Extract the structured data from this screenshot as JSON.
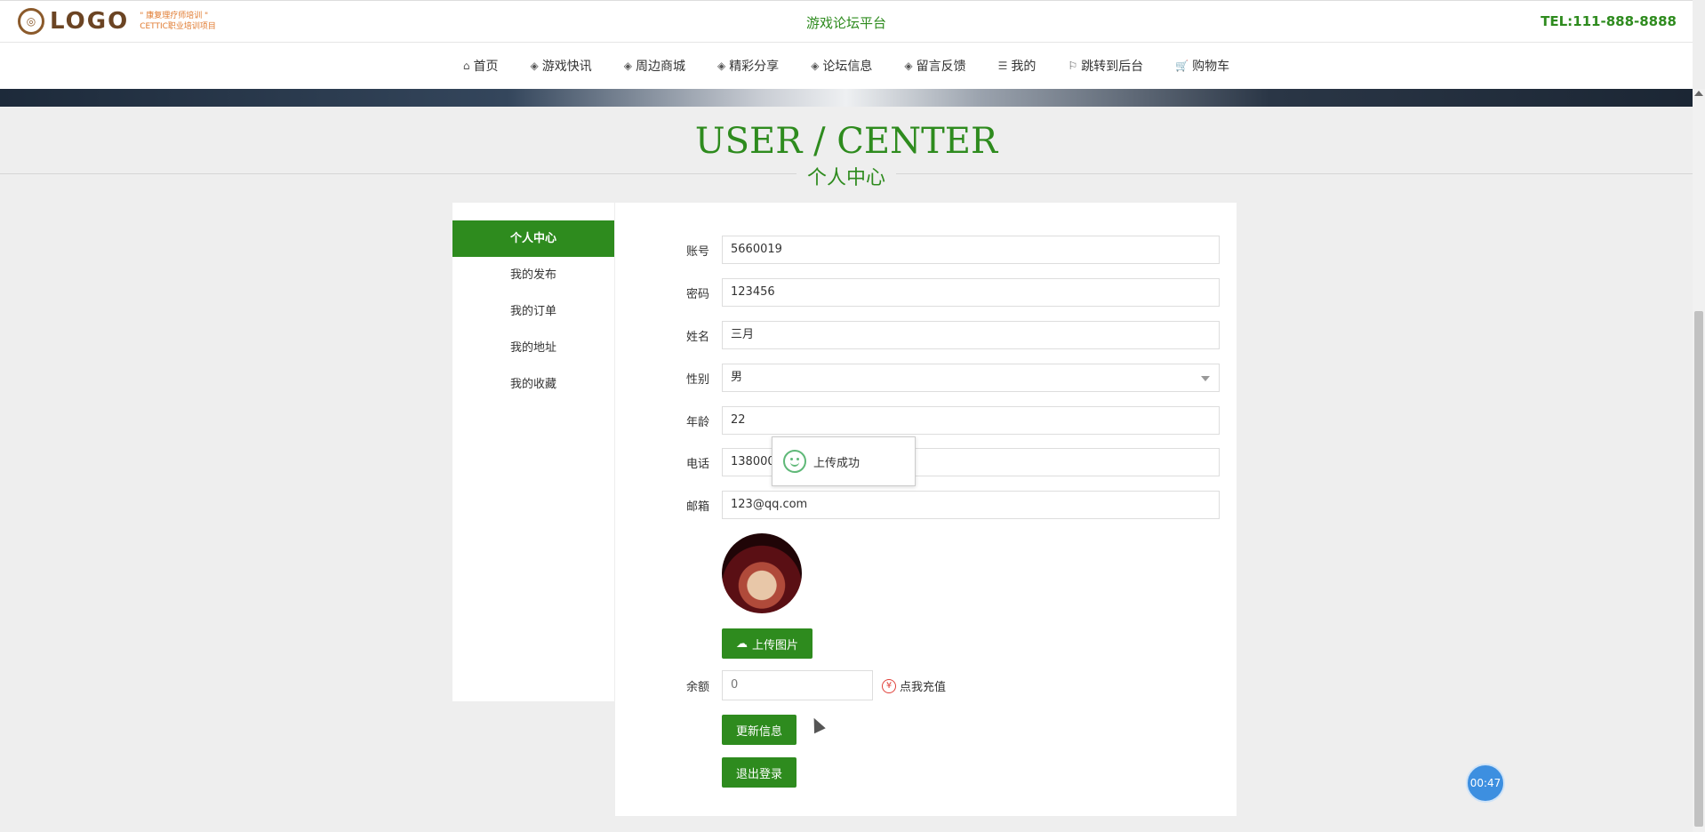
{
  "header": {
    "logo_text": "LOGO",
    "logo_sub1": "\" 康复理疗师培训 \"",
    "logo_sub2": "CETTIC职业培训项目",
    "site_title": "游戏论坛平台",
    "tel": "TEL:111-888-8888"
  },
  "nav": {
    "items": [
      {
        "label": "首页",
        "icon": "home-icon"
      },
      {
        "label": "游戏快讯",
        "icon": "cube-icon"
      },
      {
        "label": "周边商城",
        "icon": "cube-icon"
      },
      {
        "label": "精彩分享",
        "icon": "cube-icon"
      },
      {
        "label": "论坛信息",
        "icon": "cube-icon"
      },
      {
        "label": "留言反馈",
        "icon": "cube-icon"
      },
      {
        "label": "我的",
        "icon": "list-icon"
      },
      {
        "label": "跳转到后台",
        "icon": "flag-icon"
      },
      {
        "label": "购物车",
        "icon": "cart-icon"
      }
    ]
  },
  "title": {
    "en": "USER / CENTER",
    "cn": "个人中心"
  },
  "sidebar": {
    "items": [
      {
        "label": "个人中心",
        "active": true
      },
      {
        "label": "我的发布"
      },
      {
        "label": "我的订单"
      },
      {
        "label": "我的地址"
      },
      {
        "label": "我的收藏"
      }
    ]
  },
  "form": {
    "account": {
      "label": "账号",
      "value": "5660019"
    },
    "password": {
      "label": "密码",
      "value": "123456"
    },
    "name": {
      "label": "姓名",
      "value": "三月"
    },
    "gender": {
      "label": "性别",
      "value": "男"
    },
    "age": {
      "label": "年龄",
      "value": "22"
    },
    "phone": {
      "label": "电话",
      "value": "1380000"
    },
    "email": {
      "label": "邮箱",
      "value": "123@qq.com"
    },
    "upload_label": "上传图片",
    "balance": {
      "label": "余额",
      "value": "0"
    },
    "recharge_label": "点我充值",
    "update_label": "更新信息",
    "logout_label": "退出登录"
  },
  "toast": {
    "message": "上传成功"
  },
  "timer": {
    "value": "00:47"
  },
  "colors": {
    "accent": "#2e8b1e",
    "background": "#eeeeee"
  }
}
